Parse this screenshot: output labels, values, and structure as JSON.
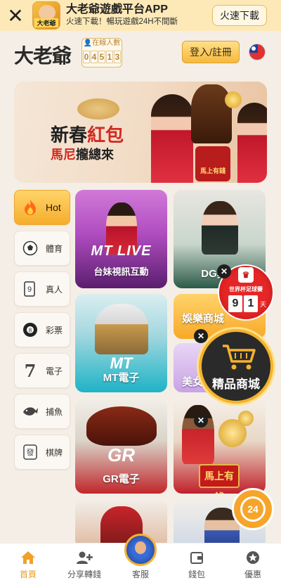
{
  "app_banner": {
    "title": "大老爺遊戲平台APP",
    "subtitle": "火速下載！暢玩遊戲24H不間斷",
    "download_label": "火速下載",
    "icon_text": "大老爺"
  },
  "header": {
    "logo": "大老爺",
    "online_label": "在線人數",
    "online_digits": [
      "0",
      "4",
      "5",
      "1",
      "3"
    ],
    "login_label": "登入/註冊"
  },
  "promo": {
    "title_black": "新春",
    "title_red": "紅包",
    "subtitle_red": "馬尼",
    "subtitle_black": "攏總來",
    "box_text": "馬上有錢"
  },
  "categories": [
    {
      "label": "Hot",
      "icon": "fire-icon",
      "active": true
    },
    {
      "label": "體育",
      "icon": "soccer-ball-icon",
      "active": false
    },
    {
      "label": "真人",
      "icon": "poker-chip-icon",
      "active": false
    },
    {
      "label": "彩票",
      "icon": "eight-ball-icon",
      "active": false
    },
    {
      "label": "電子",
      "icon": "slot-seven-icon",
      "active": false
    },
    {
      "label": "捕魚",
      "icon": "fish-icon",
      "active": false
    },
    {
      "label": "棋牌",
      "icon": "mahjong-tile-icon",
      "active": false
    }
  ],
  "tiles": {
    "mt_live": {
      "logo": "MT LIVE",
      "label": "台妹視訊互動"
    },
    "dg": {
      "label": "DG真人"
    },
    "mt_slot": {
      "logo": "MT",
      "label": "MT電子"
    },
    "mall": {
      "label": "娛樂商城"
    },
    "beauty": {
      "label": "美女"
    },
    "gr": {
      "logo": "GR",
      "label": "GR電子"
    },
    "gold": {
      "label": "馬上有錢"
    }
  },
  "world_cup": {
    "label": "世界杯足球賽",
    "digits": [
      "9",
      "1"
    ],
    "unit": "天"
  },
  "mall_badge": {
    "label": "精品商城"
  },
  "support": {
    "label": "24"
  },
  "bottom_nav": [
    {
      "label": "首頁",
      "icon": "home-icon",
      "active": true
    },
    {
      "label": "分享轉錢",
      "icon": "add-user-icon",
      "active": false
    },
    {
      "label": "客服",
      "icon": "avatar",
      "active": false
    },
    {
      "label": "錢包",
      "icon": "wallet-icon",
      "active": false
    },
    {
      "label": "優惠",
      "icon": "star-badge-icon",
      "active": false
    }
  ],
  "colors": {
    "accent": "#f6b22c",
    "active_nav": "#e99c1c",
    "page_bg": "#f4eee6"
  }
}
